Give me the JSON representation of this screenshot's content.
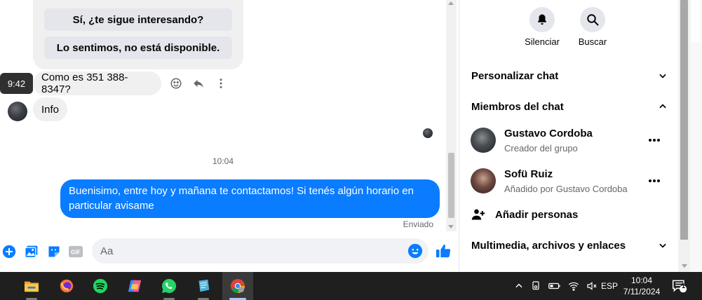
{
  "quick_replies": [
    "Sí, ¿te sigue interesando?",
    "Lo sentimos, no está disponible."
  ],
  "messages": {
    "hover_time": "9:42",
    "incoming": [
      "Como es 351 388-8347?",
      "Info"
    ],
    "timestamp": "10:04",
    "outgoing": "Buenisimo, entre hoy y mañana te contactamos! Si tenés algún horario en particular avisame",
    "status": "Enviado"
  },
  "composer": {
    "placeholder": "Aa",
    "gif_label": "GIF"
  },
  "panel": {
    "actions": [
      {
        "label": "Silenciar",
        "icon": "bell-icon"
      },
      {
        "label": "Buscar",
        "icon": "search-icon"
      }
    ],
    "sections": {
      "customize": "Personalizar chat",
      "members": "Miembros del chat",
      "media": "Multimedia, archivos y enlaces"
    },
    "members": [
      {
        "name": "Gustavo Cordoba",
        "role": "Creador del grupo"
      },
      {
        "name": "Sofü Ruiz",
        "role": "Añadido por Gustavo Cordoba"
      }
    ],
    "add_people": "Añadir personas"
  },
  "taskbar": {
    "apps": [
      "file-explorer-icon",
      "firefox-icon",
      "spotify-icon",
      "copilot-icon",
      "whatsapp-icon",
      "notepad-icon",
      "chrome-icon"
    ],
    "lang": "ESP",
    "time": "10:04",
    "date": "7/11/2024",
    "notifications": "1"
  },
  "colors": {
    "accent": "#0a7cff",
    "bubble_in": "#f0f0f0",
    "taskbar": "#1f1f1f"
  }
}
